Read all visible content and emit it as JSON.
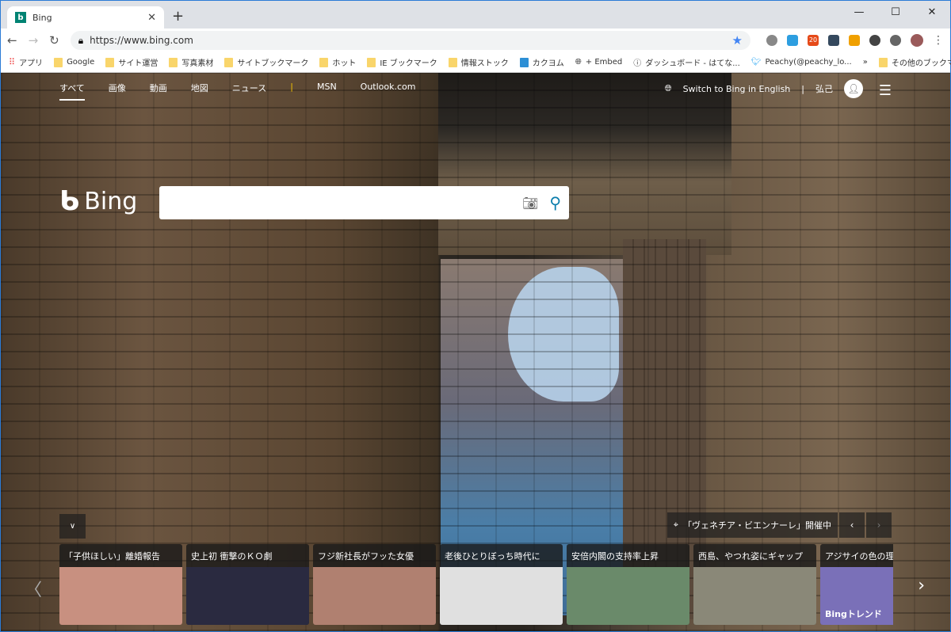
{
  "browser": {
    "tab_title": "Bing",
    "url": "https://www.bing.com",
    "bookmarks": [
      "アプリ",
      "Google",
      "サイト運営",
      "写真素材",
      "サイトブックマーク",
      "ホット",
      "IE ブックマーク",
      "情報ストック",
      "カクヨム",
      "+ Embed",
      "ダッシュボード - はてな...",
      "Peachy(@peachy_lo..."
    ],
    "other_bookmarks": "その他のブックマーク",
    "badge": "20"
  },
  "nav": {
    "items": [
      "すべて",
      "画像",
      "動画",
      "地図",
      "ニュース",
      "MSN",
      "Outlook.com"
    ],
    "switch_lang": "Switch to Bing in English",
    "user": "弘己"
  },
  "logo": "Bing",
  "search": {
    "placeholder": ""
  },
  "location": "「ヴェネチア・ビエンナーレ」開催中",
  "cards": [
    {
      "title": "「子供ほしい」離婚報告",
      "color": "#c89080"
    },
    {
      "title": "史上初 衝撃のＫＯ劇",
      "color": "#2a2a40"
    },
    {
      "title": "フジ新社長がフッた女優",
      "color": "#b08070"
    },
    {
      "title": "老後ひとりぼっち時代に",
      "color": "#e0e0e0"
    },
    {
      "title": "安倍内閣の支持率上昇",
      "color": "#6a8a6a"
    },
    {
      "title": "西島、やつれ姿にギャップ",
      "color": "#8a8878"
    },
    {
      "title": "アジサイの色の理",
      "color": "#7a70b8"
    }
  ],
  "trend_label": "Bingトレンド"
}
